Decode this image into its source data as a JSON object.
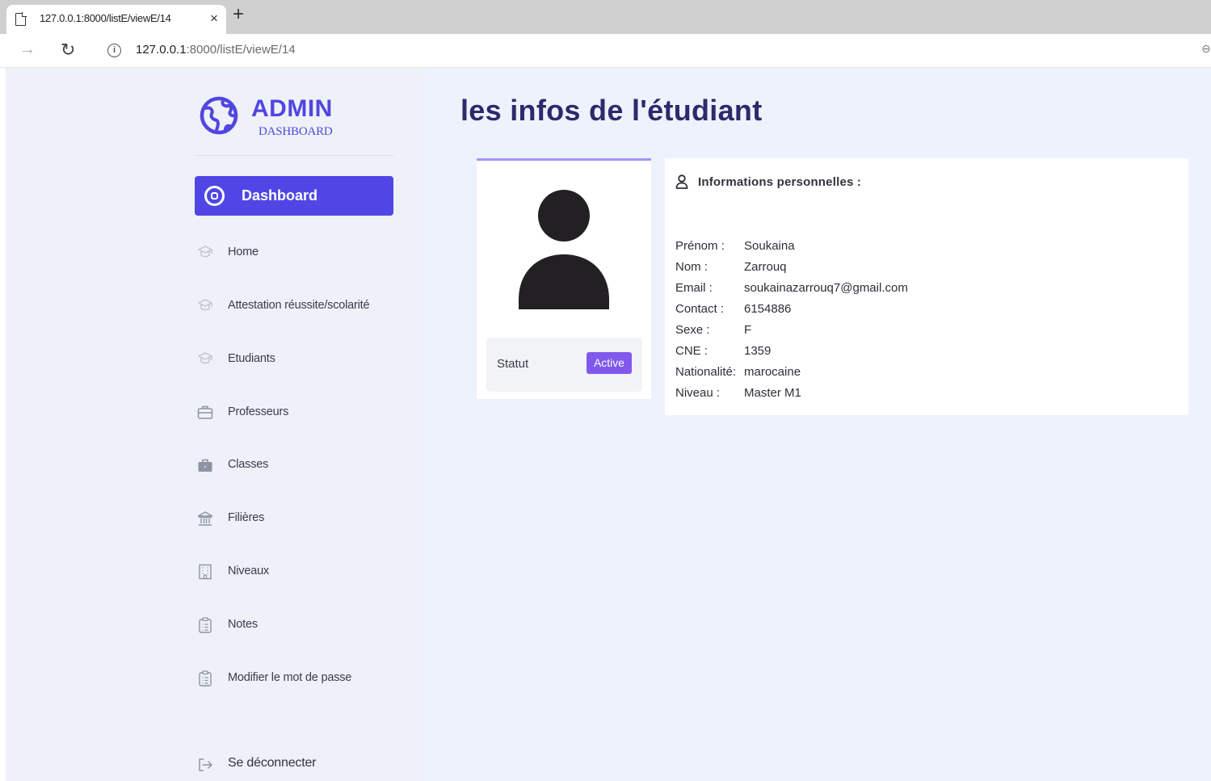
{
  "browser": {
    "tab_title": "127.0.0.1:8000/listE/viewE/14",
    "tab_close": "×",
    "new_tab": "+",
    "url_host": "127.0.0.1",
    "url_path": ":8000/listE/viewE/14"
  },
  "sidebar": {
    "brand_title": "ADMIN",
    "brand_subtitle": "DASHBOARD",
    "active_item": {
      "label": "Dashboard",
      "icon": "dashboard-icon"
    },
    "items": [
      {
        "label": "Home",
        "icon": "graduation-cap-icon"
      },
      {
        "label": "Attestation réussite/scolarité",
        "icon": "graduation-cap-icon"
      },
      {
        "label": "Etudiants",
        "icon": "graduation-cap-icon"
      },
      {
        "label": "Professeurs",
        "icon": "briefcase-icon"
      },
      {
        "label": "Classes",
        "icon": "briefcase-solid-icon"
      },
      {
        "label": "Filières",
        "icon": "bank-icon"
      },
      {
        "label": "Niveaux",
        "icon": "building-icon"
      },
      {
        "label": "Notes",
        "icon": "clipboard-icon"
      },
      {
        "label": "Modifier le mot de passe",
        "icon": "clipboard-icon"
      }
    ],
    "logout": {
      "label": "Se déconnecter",
      "icon": "logout-icon"
    }
  },
  "main": {
    "title": "les infos de l'étudiant",
    "profile": {
      "status_label": "Statut",
      "status_value": "Active"
    },
    "info": {
      "heading": "Informations personnelles :",
      "rows": [
        {
          "label": "Prénom :",
          "value": "Soukaina"
        },
        {
          "label": "Nom :",
          "value": "Zarrouq"
        },
        {
          "label": "Email :",
          "value": "soukainazarrouq7@gmail.com"
        },
        {
          "label": "Contact :",
          "value": "6154886"
        },
        {
          "label": "Sexe :",
          "value": "F"
        },
        {
          "label": "CNE :",
          "value": "1359"
        },
        {
          "label": "Nationalité:",
          "value": "marocaine"
        },
        {
          "label": "Niveau :",
          "value": "Master M1"
        }
      ]
    }
  },
  "colors": {
    "accent": "#4f46e5",
    "badge": "#8058ec",
    "card_top_border": "#a594f3",
    "title": "#2c2a6b",
    "page_bg": "#edf2fd",
    "sidebar_bg": "#eef1f7"
  }
}
